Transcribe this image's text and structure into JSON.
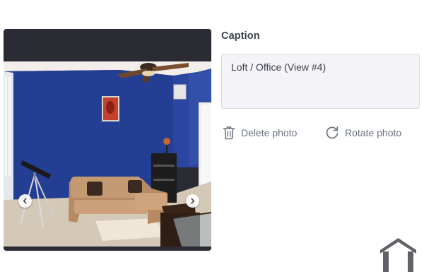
{
  "caption": {
    "label": "Caption",
    "value": "Loft / Office (View #4)"
  },
  "actions": {
    "delete_label": "Delete photo",
    "rotate_label": "Rotate photo"
  },
  "photo": {
    "scene": "living room photo",
    "icons": {
      "prev": "chevron-left-icon",
      "next": "chevron-right-icon"
    }
  },
  "brand": {
    "icon": "house-logo-icon"
  },
  "colors": {
    "viewer_bg": "#2a2b33",
    "caption_bg": "#f4f4f8",
    "action_text": "#6a7280",
    "logo": "#5f6266"
  }
}
